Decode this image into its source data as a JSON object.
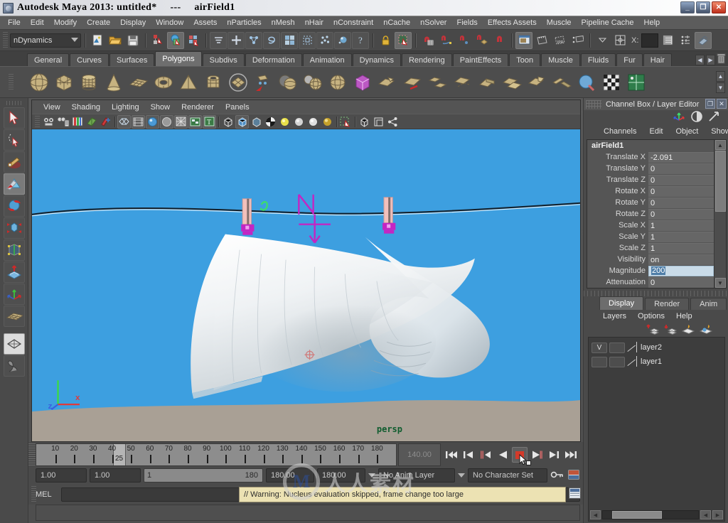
{
  "window": {
    "title": "Autodesk Maya 2013: untitled*     ---     airField1",
    "buttons": {
      "minimize": "_",
      "maximize": "❐",
      "close": "✕"
    }
  },
  "menubar": {
    "items": [
      "File",
      "Edit",
      "Modify",
      "Create",
      "Display",
      "Window",
      "Assets",
      "nParticles",
      "nMesh",
      "nHair",
      "nConstraint",
      "nCache",
      "nSolver",
      "Fields",
      "Effects Assets",
      "Muscle",
      "Pipeline Cache",
      "Help"
    ]
  },
  "statusbar": {
    "menuset": "nDynamics",
    "icons": [
      "new-scene-icon",
      "open-scene-icon",
      "save-scene-icon",
      "select-hierarchy-icon",
      "select-object-icon",
      "select-component-icon",
      "snap-to-curve-icon",
      "move-icon",
      "construction-history-icon",
      "snap-spiral-icon",
      "render-view-icon",
      "render-sequence-icon",
      "ipr-render-icon",
      "render-settings-icon",
      "lock-icon",
      "select-box-icon",
      "snap-grid-icon",
      "snap-curve-icon",
      "snap-point-icon",
      "snap-plane-icon",
      "snap-view-icon",
      "snap-live-icon",
      "show-manipulator-icon",
      "no-live-surface-icon",
      "channel-box-icon",
      "attribute-editor-icon",
      "tool-settings-icon"
    ]
  },
  "shelf": {
    "tabs": [
      "General",
      "Curves",
      "Surfaces",
      "Polygons",
      "Subdivs",
      "Deformation",
      "Animation",
      "Dynamics",
      "Rendering",
      "PaintEffects",
      "Toon",
      "Muscle",
      "Fluids",
      "Fur",
      "Hair"
    ],
    "selected": "Polygons",
    "nav": {
      "prev": "◀",
      "next": "▶",
      "trash": "trash-icon"
    },
    "items": [
      "poly-sphere-icon",
      "poly-cube-icon",
      "poly-cylinder-icon",
      "poly-cone-icon",
      "poly-plane-icon",
      "poly-torus-icon",
      "poly-pyramid-icon",
      "poly-pipe-icon",
      "poly-disc-icon",
      "poly-combine-icon",
      "poly-boolean-icon",
      "poly-smooth-icon",
      "poly-triangulate-icon",
      "poly-selected-cube-icon",
      "poly-extrude-icon",
      "poly-bevel-icon",
      "poly-bridge-icon",
      "poly-append-icon",
      "poly-wedge-icon",
      "poly-duplicate-face-icon",
      "poly-extract-icon",
      "poly-mirror-icon",
      "poly-sculpt-icon",
      "poly-uv-checker-icon",
      "poly-uv-snapshot-icon"
    ]
  },
  "toolbox": {
    "tools": [
      {
        "name": "select-tool-icon",
        "selected": false
      },
      {
        "name": "lasso-select-tool-icon",
        "selected": false
      },
      {
        "name": "paint-select-tool-icon",
        "selected": false
      },
      {
        "name": "move-tool-icon",
        "selected": true
      },
      {
        "name": "rotate-tool-icon",
        "selected": false
      },
      {
        "name": "scale-tool-icon",
        "selected": false
      },
      {
        "name": "universal-manipulator-icon",
        "selected": false
      },
      {
        "name": "soft-modification-tool-icon",
        "selected": false
      },
      {
        "name": "show-manipulator-tool-icon",
        "selected": false
      },
      {
        "name": "last-tool-used-icon",
        "selected": false
      },
      {
        "name": "single-perspective-layout-icon",
        "selected": false
      },
      {
        "name": "four-view-layout-icon",
        "selected": false
      }
    ]
  },
  "viewport": {
    "menus": [
      "View",
      "Shading",
      "Lighting",
      "Show",
      "Renderer",
      "Panels"
    ],
    "toolbar_icons": [
      "select-camera-icon",
      "camera-attributes-icon",
      "book-icon",
      "image-plane-icon",
      "keyframe-icon",
      "wireframe-icon",
      "film-gate-icon",
      "smooth-shade-icon",
      "flat-shade-icon",
      "wireframe-on-shaded-icon",
      "texture-icon",
      "text-icon",
      "xray-icon",
      "xray-joints-icon",
      "xray-active-icon",
      "checker-icon",
      "light-bulb-icon",
      "default-light-icon",
      "all-lights-icon",
      "shadows-icon",
      "isolate-select-icon",
      "grid-toggle-icon",
      "panel-toggle-icon",
      "share-icon"
    ],
    "camera_label": "persp",
    "background_color": "#3d9fe0",
    "ground_color": "#a9a095",
    "field_manipulator_color": "#c326c3"
  },
  "timeslider": {
    "ticks": [
      10,
      20,
      30,
      40,
      50,
      60,
      70,
      80,
      90,
      100,
      110,
      120,
      130,
      140,
      150,
      160,
      170,
      180
    ],
    "current_frame_marker": "25",
    "current_frame_field": "140.00",
    "playback_buttons": [
      "go-to-start-icon",
      "step-back-frame-icon",
      "step-back-key-icon",
      "play-backwards-icon",
      "stop-playback-icon",
      "play-forwards-icon",
      "step-forward-key-icon",
      "go-to-end-icon"
    ]
  },
  "rangeslider": {
    "anim_start": "1.00",
    "range_start": "1.00",
    "bar_min": "1",
    "bar_max": "180",
    "range_end": "180.00",
    "anim_end": "180.00",
    "anim_layer": "No Anim Layer",
    "character_set": "No Character Set",
    "key_icon": "auto-key-icon",
    "prefs_icon": "animation-preferences-icon"
  },
  "commandline": {
    "language_label": "MEL",
    "input_value": "",
    "message": "// Warning: Nucleus evaluation skipped, frame change too large",
    "script_editor_icon": "script-editor-icon"
  },
  "channelbox": {
    "title": "Channel Box / Layer Editor",
    "window_buttons": {
      "undock": "❐",
      "close": "✕"
    },
    "header_icons": [
      "show-manipulators-icon",
      "channel-box-icon",
      "attribute-editor-icon"
    ],
    "menus": [
      "Channels",
      "Edit",
      "Object",
      "Show"
    ],
    "node_name": "airField1",
    "channels": [
      {
        "name": "Translate X",
        "value": "-2.091",
        "editing": false
      },
      {
        "name": "Translate Y",
        "value": "0",
        "editing": false
      },
      {
        "name": "Translate Z",
        "value": "0",
        "editing": false
      },
      {
        "name": "Rotate X",
        "value": "0",
        "editing": false
      },
      {
        "name": "Rotate Y",
        "value": "0",
        "editing": false
      },
      {
        "name": "Rotate Z",
        "value": "0",
        "editing": false
      },
      {
        "name": "Scale X",
        "value": "1",
        "editing": false
      },
      {
        "name": "Scale Y",
        "value": "1",
        "editing": false
      },
      {
        "name": "Scale Z",
        "value": "1",
        "editing": false
      },
      {
        "name": "Visibility",
        "value": "on",
        "editing": false
      },
      {
        "name": "Magnitude",
        "value": "200",
        "editing": true
      },
      {
        "name": "Attenuation",
        "value": "0",
        "editing": false
      }
    ]
  },
  "layereditor": {
    "tabs": [
      "Display",
      "Render",
      "Anim"
    ],
    "selected_tab": "Display",
    "menus": [
      "Layers",
      "Options",
      "Help"
    ],
    "toolbar_icons": [
      "move-layer-up-icon",
      "move-layer-down-icon",
      "new-layer-icon",
      "new-layer-from-selected-icon"
    ],
    "layers": [
      {
        "visibility": "V",
        "playback": "",
        "name": "layer2"
      },
      {
        "visibility": "",
        "playback": "",
        "name": "layer1"
      }
    ]
  },
  "watermark": {
    "letter": "M",
    "text": "人人素材"
  }
}
